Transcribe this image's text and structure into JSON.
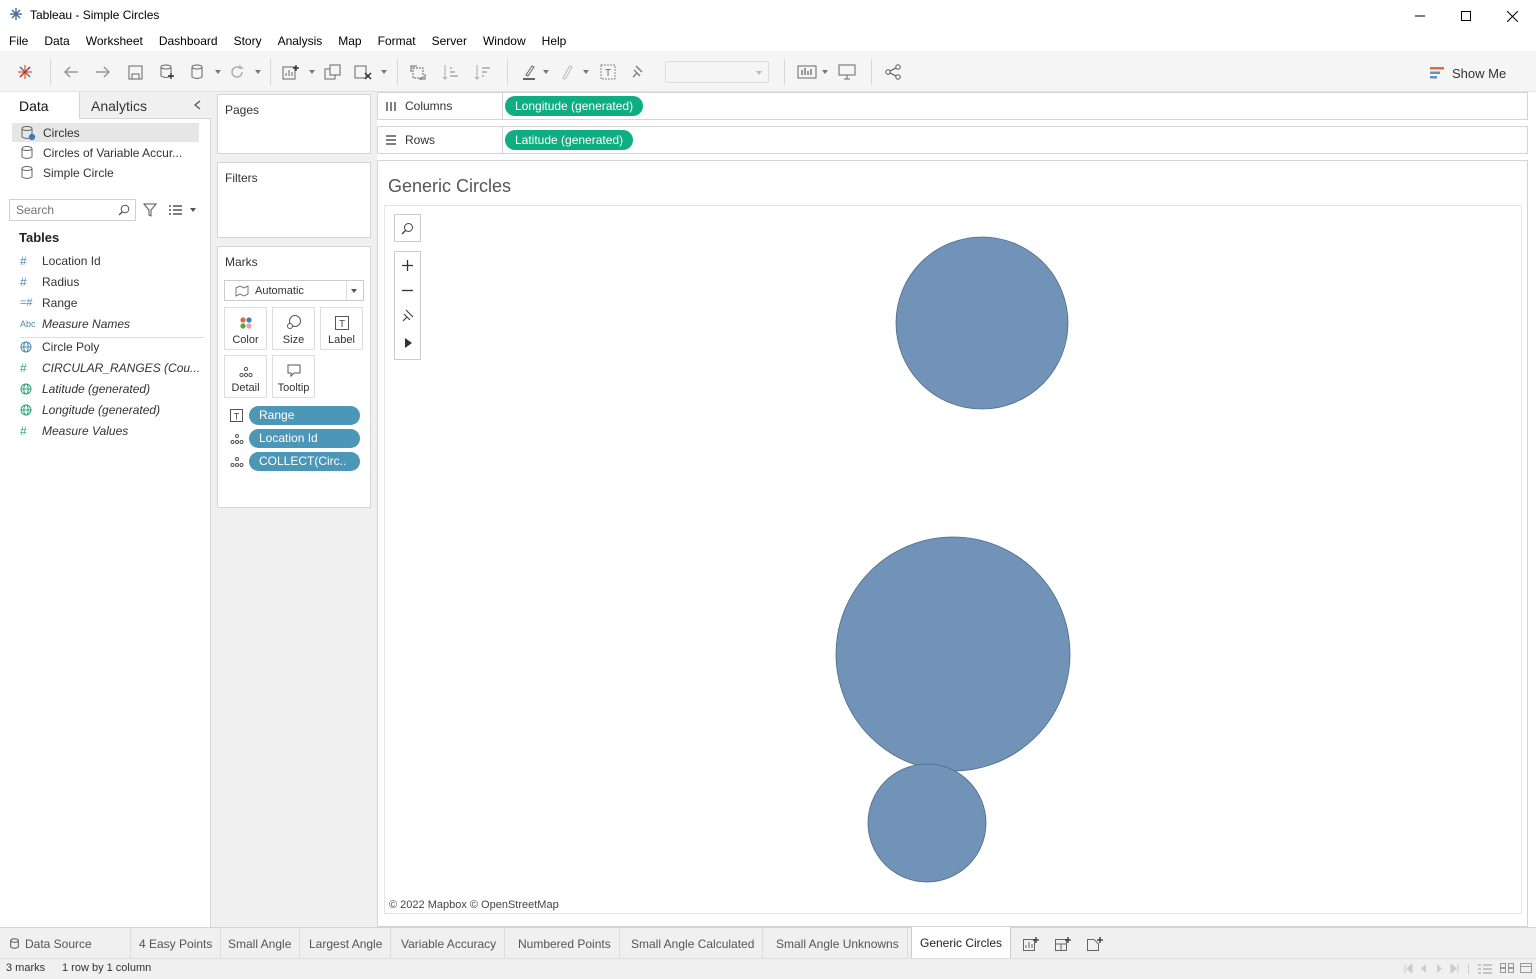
{
  "window": {
    "title": "Tableau - Simple Circles"
  },
  "menu": [
    "File",
    "Data",
    "Worksheet",
    "Dashboard",
    "Story",
    "Analysis",
    "Map",
    "Format",
    "Server",
    "Window",
    "Help"
  ],
  "toolbar": {
    "show_me": "Show Me"
  },
  "data_pane": {
    "tabs": {
      "data": "Data",
      "analytics": "Analytics"
    },
    "datasources": [
      "Circles",
      "Circles of Variable Accur...",
      "Simple Circle"
    ],
    "search_placeholder": "Search",
    "tables_header": "Tables",
    "fields": [
      {
        "icon": "#",
        "name": "Location Id"
      },
      {
        "icon": "#",
        "name": "Radius"
      },
      {
        "icon": "=#",
        "name": "Range"
      },
      {
        "icon": "Abc",
        "name": "Measure Names"
      },
      {
        "icon": "globe",
        "name": "Circle Poly"
      },
      {
        "icon": "#",
        "name": "CIRCULAR_RANGES (Cou..."
      },
      {
        "icon": "globe",
        "name": "Latitude (generated)"
      },
      {
        "icon": "globe",
        "name": "Longitude (generated)"
      },
      {
        "icon": "#",
        "name": "Measure Values"
      }
    ]
  },
  "cards": {
    "pages": "Pages",
    "filters": "Filters",
    "marks": {
      "title": "Marks",
      "type": "Automatic",
      "buttons": [
        "Color",
        "Size",
        "Label",
        "Detail",
        "Tooltip"
      ],
      "pills": [
        "Range",
        "Location Id",
        "COLLECT(Circ.."
      ]
    }
  },
  "shelves": {
    "columns_label": "Columns",
    "columns_pill": "Longitude (generated)",
    "rows_label": "Rows",
    "rows_pill": "Latitude (generated)"
  },
  "view": {
    "title": "Generic Circles",
    "attribution": "© 2022 Mapbox © OpenStreetMap",
    "circle_color": "#7193b8"
  },
  "sheet_tabs": [
    "Data Source",
    "4 Easy Points",
    "Small Angle",
    "Largest Angle",
    "Variable Accuracy",
    "Numbered Points",
    "Small Angle Calculated",
    "Small Angle Unknowns",
    "Generic Circles"
  ],
  "active_tab": "Generic Circles",
  "status": {
    "marks": "3 marks",
    "dims": "1 row by 1 column"
  },
  "colors": {
    "green_pill": "#0fae82",
    "blue_pill": "#4c96b8"
  }
}
